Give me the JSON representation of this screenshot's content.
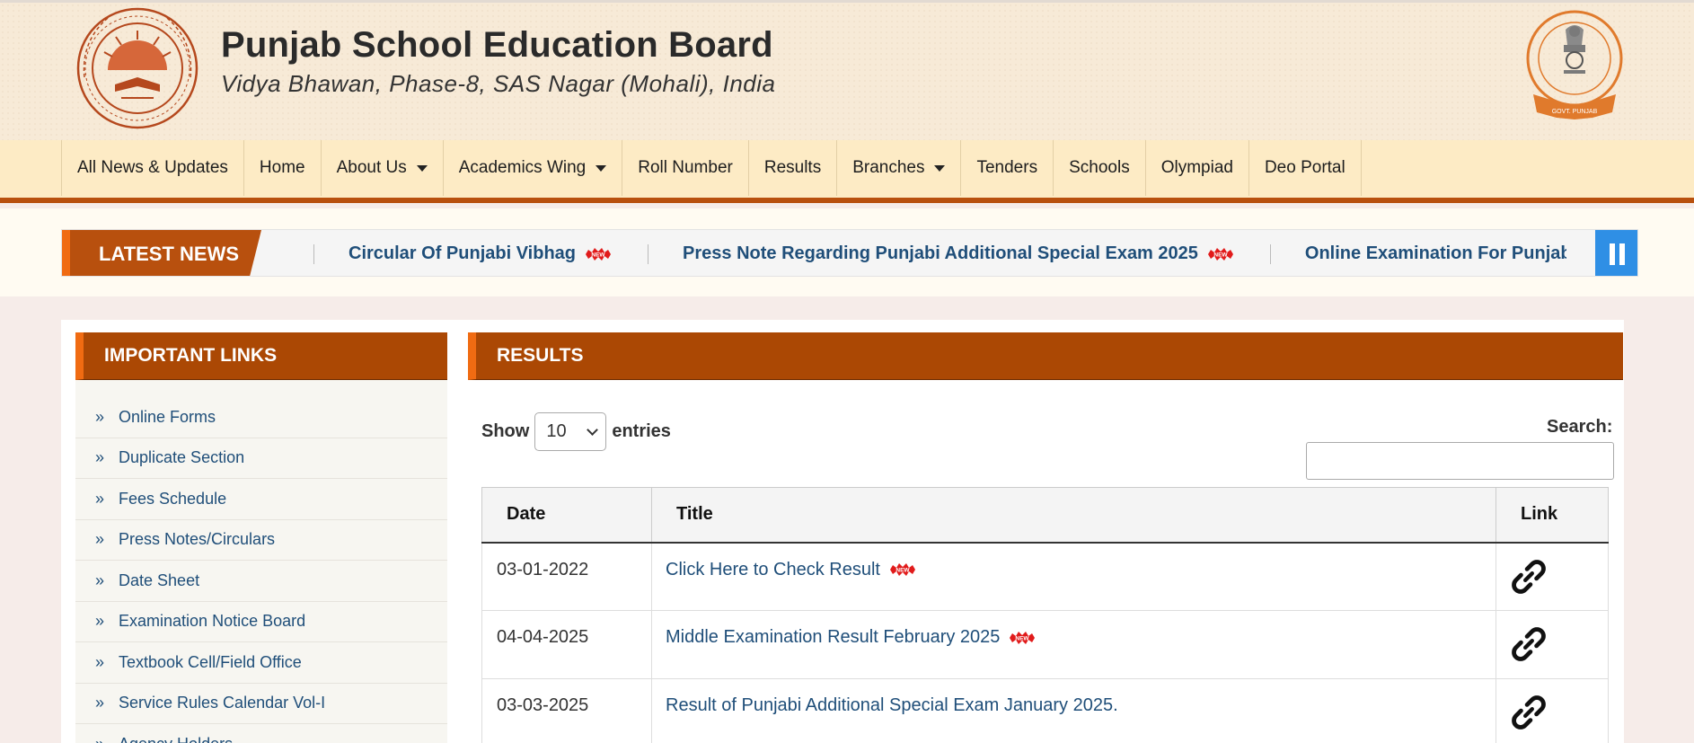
{
  "header": {
    "title": "Punjab School Education Board",
    "subtitle": "Vidya Bhawan, Phase-8, SAS Nagar (Mohali), India",
    "logo_left_icon": "pseb-seal-logo",
    "logo_right_icon": "govt-punjab-emblem",
    "logo_right_ribbon": "GOVT. PUNJAB"
  },
  "nav": {
    "items": [
      {
        "label": "All News & Updates",
        "dropdown": false
      },
      {
        "label": "Home",
        "dropdown": false
      },
      {
        "label": "About Us",
        "dropdown": true
      },
      {
        "label": "Academics Wing",
        "dropdown": true
      },
      {
        "label": "Roll Number",
        "dropdown": false
      },
      {
        "label": "Results",
        "dropdown": false
      },
      {
        "label": "Branches",
        "dropdown": true
      },
      {
        "label": "Tenders",
        "dropdown": false
      },
      {
        "label": "Schools",
        "dropdown": false
      },
      {
        "label": "Olympiad",
        "dropdown": false
      },
      {
        "label": "Deo Portal",
        "dropdown": false
      }
    ]
  },
  "ticker": {
    "label": "LATEST NEWS",
    "items": [
      {
        "text": "Circular Of Punjabi Vibhag",
        "new": true
      },
      {
        "text": "Press Note Regarding Punjabi Additional Special Exam 2025",
        "new": true
      },
      {
        "text": "Online Examination For Punjabi A",
        "new": false
      }
    ],
    "pause_icon": "pause-icon"
  },
  "important_links": {
    "title": "IMPORTANT LINKS",
    "items": [
      "Online Forms",
      "Duplicate Section",
      "Fees Schedule",
      "Press Notes/Circulars",
      "Date Sheet",
      "Examination Notice Board",
      "Textbook Cell/Field Office",
      "Service Rules Calendar Vol-I",
      "Agency Holders"
    ]
  },
  "results": {
    "title": "RESULTS",
    "show_label": "Show",
    "entries_value": "10",
    "entries_label": "entries",
    "search_label": "Search:",
    "search_value": "",
    "columns": [
      "Date",
      "Title",
      "Link"
    ],
    "rows": [
      {
        "date": "03-01-2022",
        "title": "Click Here to Check Result",
        "new": true
      },
      {
        "date": "04-04-2025",
        "title": "Middle Examination Result February 2025",
        "new": true
      },
      {
        "date": "03-03-2025",
        "title": "Result of Punjabi Additional Special Exam January 2025.",
        "new": false
      }
    ]
  },
  "colors": {
    "accent_brown": "#ab4804",
    "accent_orange": "#f06b12",
    "link_blue": "#1f4e79",
    "pause_blue": "#2f8fe5",
    "nav_bg": "#fdebc5"
  }
}
